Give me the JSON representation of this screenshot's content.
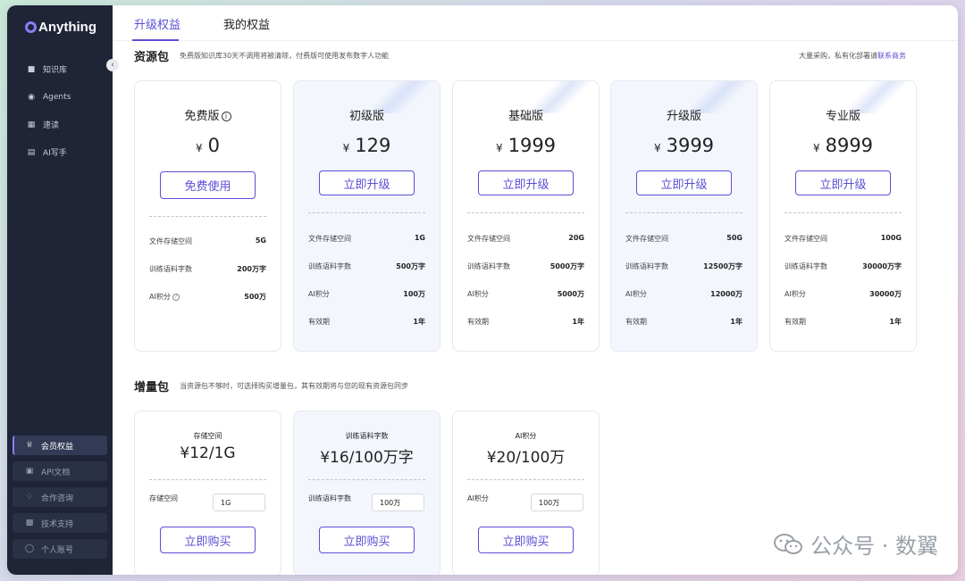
{
  "app": {
    "logo_text": "Anything"
  },
  "sidebar": {
    "items": [
      {
        "label": "知识库",
        "icon": "book-icon"
      },
      {
        "label": "Agents",
        "icon": "robot-icon"
      },
      {
        "label": "速读",
        "icon": "reader-icon"
      },
      {
        "label": "AI写手",
        "icon": "writer-icon"
      }
    ],
    "bottom_items": [
      {
        "label": "会员权益",
        "icon": "crown-icon",
        "active": true
      },
      {
        "label": "API文档",
        "icon": "doc-icon"
      },
      {
        "label": "合作咨询",
        "icon": "handshake-icon"
      },
      {
        "label": "技术支持",
        "icon": "qr-icon"
      },
      {
        "label": "个人账号",
        "icon": "user-icon"
      }
    ]
  },
  "tabs": [
    {
      "label": "升级权益",
      "active": true
    },
    {
      "label": "我的权益"
    }
  ],
  "resource": {
    "title": "资源包",
    "desc": "免费版知识库30天不调用将被清除，付费版可使用发布数字人功能",
    "bulk_note": "大量采购，私有化部署请",
    "bulk_link": "联系商务",
    "plans": [
      {
        "name": "免费版",
        "currency": "¥",
        "price": "0",
        "button": "免费使用",
        "rows": [
          [
            "文件存储空间",
            "5G"
          ],
          [
            "训练语料字数",
            "200万字"
          ],
          [
            "AI积分",
            "500万"
          ]
        ]
      },
      {
        "name": "初级版",
        "currency": "¥",
        "price": "129",
        "button": "立即升级",
        "rows": [
          [
            "文件存储空间",
            "1G"
          ],
          [
            "训练语料字数",
            "500万字"
          ],
          [
            "AI积分",
            "100万"
          ],
          [
            "有效期",
            "1年"
          ]
        ]
      },
      {
        "name": "基础版",
        "currency": "¥",
        "price": "1999",
        "button": "立即升级",
        "rows": [
          [
            "文件存储空间",
            "20G"
          ],
          [
            "训练语料字数",
            "5000万字"
          ],
          [
            "AI积分",
            "5000万"
          ],
          [
            "有效期",
            "1年"
          ]
        ]
      },
      {
        "name": "升级版",
        "currency": "¥",
        "price": "3999",
        "button": "立即升级",
        "rows": [
          [
            "文件存储空间",
            "50G"
          ],
          [
            "训练语料字数",
            "12500万字"
          ],
          [
            "AI积分",
            "12000万"
          ],
          [
            "有效期",
            "1年"
          ]
        ]
      },
      {
        "name": "专业版",
        "currency": "¥",
        "price": "8999",
        "button": "立即升级",
        "rows": [
          [
            "文件存储空间",
            "100G"
          ],
          [
            "训练语料字数",
            "30000万字"
          ],
          [
            "AI积分",
            "30000万"
          ],
          [
            "有效期",
            "1年"
          ]
        ]
      }
    ]
  },
  "addon": {
    "title": "增量包",
    "desc": "当资源包不够时，可选择购买增量包，其有效期将与您的现有资源包同步",
    "packs": [
      {
        "name": "存储空间",
        "price": "¥12/1G",
        "field_label": "存储空间",
        "field_value": "1G",
        "button": "立即购买"
      },
      {
        "name": "训练语料字数",
        "price": "¥16/100万字",
        "field_label": "训练语料字数",
        "field_value": "100万",
        "button": "立即购买"
      },
      {
        "name": "AI积分",
        "price": "¥20/100万",
        "field_label": "AI积分",
        "field_value": "100万",
        "button": "立即购买"
      }
    ]
  },
  "watermark": {
    "text": "公众号 · 数翼"
  }
}
